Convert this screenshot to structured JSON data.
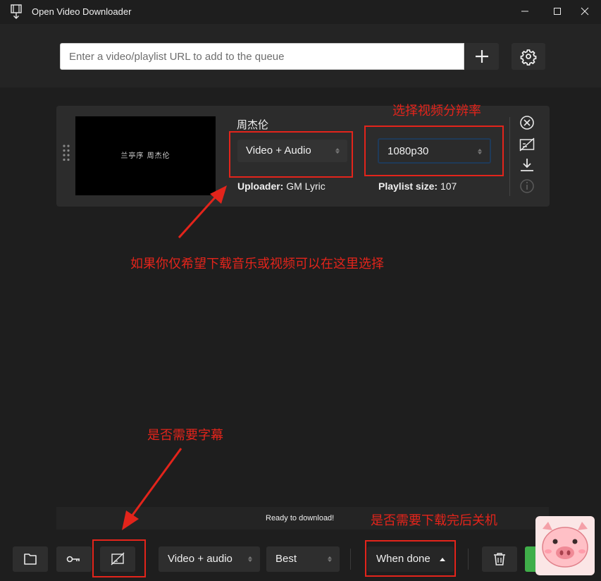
{
  "window": {
    "title": "Open Video Downloader",
    "min": "—",
    "max": "☐",
    "close": "✕"
  },
  "header": {
    "url_placeholder": "Enter a video/playlist URL to add to the queue",
    "add_icon": "plus-icon",
    "settings_icon": "gear-icon"
  },
  "video": {
    "thumbnail_text": "兰亭序 周杰伦",
    "title": "周杰伦",
    "type_value": "Video + Audio",
    "resolution_value": "1080p30",
    "uploader_label": "Uploader:",
    "uploader_value": "GM Lyric",
    "playlist_label": "Playlist size:",
    "playlist_value": "107",
    "actions": [
      "close-circle-icon",
      "subtitles-off-icon",
      "download-icon",
      "info-icon"
    ]
  },
  "annotations": {
    "resolution": "选择视频分辨率",
    "type": "如果你仅希望下载音乐或视频可以在这里选择",
    "subtitles": "是否需要字幕",
    "shutdown": "是否需要下载完后关机"
  },
  "footer": {
    "status": "Ready to download!",
    "type_value": "Video + audio",
    "quality_value": "Best",
    "when_done": "When done",
    "icons": [
      "folder-icon",
      "key-icon",
      "subtitles-off-icon",
      "trash-icon"
    ]
  },
  "colors": {
    "annotation": "#e3241b",
    "accent_green": "#3fae49",
    "focus_border": "#1f3a59"
  }
}
